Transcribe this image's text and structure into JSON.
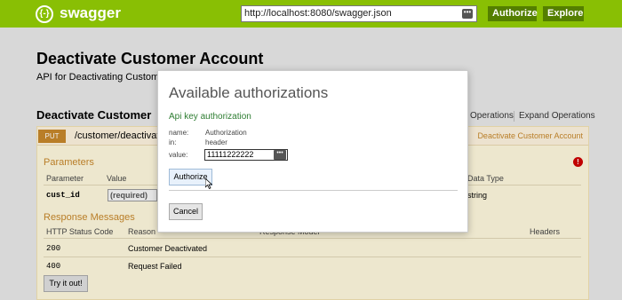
{
  "header": {
    "logo_icon": "{-}",
    "app_name": "swagger",
    "url_value": "http://localhost:8080/swagger.json",
    "url_menu_icon": "•••",
    "authorize_label": "Authorize",
    "explore_label": "Explore",
    "accent_color": "#89bf04"
  },
  "page": {
    "title": "Deactivate Customer Account",
    "description": "API for Deactivating Customer Account"
  },
  "resource": {
    "title": "Deactivate Customer",
    "list_operations": "Operations",
    "expand_operations": "Expand Operations"
  },
  "operation": {
    "method": "PUT",
    "path": "/customer/deactivate",
    "summary": "Deactivate Customer Account",
    "method_color": "#c5862b",
    "parameters_heading": "Parameters",
    "error_icon": "!",
    "param_headers": {
      "parameter": "Parameter",
      "value": "Value",
      "data_type": "Data Type"
    },
    "param_row": {
      "name": "cust_id",
      "value_placeholder": "(required)",
      "data_type": "string"
    },
    "responses_heading": "Response Messages",
    "response_headers": {
      "status": "HTTP Status Code",
      "reason": "Reason",
      "model": "Response Model",
      "headers": "Headers"
    },
    "responses": [
      {
        "code": "200",
        "reason": "Customer Deactivated"
      },
      {
        "code": "400",
        "reason": "Request Failed"
      }
    ],
    "try_label": "Try it out!"
  },
  "modal": {
    "title": "Available authorizations",
    "subtitle": "Api key authorization",
    "name_label": "name:",
    "name_value": "Authorization",
    "in_label": "in:",
    "in_value": "header",
    "value_label": "value:",
    "value_input": "11111222222",
    "value_menu_icon": "•••",
    "authorize_label": "Authorize",
    "cancel_label": "Cancel"
  }
}
